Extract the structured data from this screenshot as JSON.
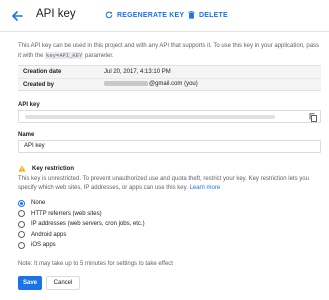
{
  "header": {
    "title": "API key",
    "regenerate_label": "REGENERATE KEY",
    "delete_label": "DELETE"
  },
  "description": {
    "text_before": "This API key can be used in this project and with any API that supports it. To use this key in your application, pass it with the ",
    "code": "key=API_KEY",
    "text_after": " parameter."
  },
  "info": {
    "creation_date_label": "Creation date",
    "creation_date_value": "Jul 20, 2017, 4:13:10 PM",
    "created_by_label": "Created by",
    "created_by_value": "@gmail.com (you)"
  },
  "api_key": {
    "label": "API key"
  },
  "name": {
    "label": "Name",
    "value": "API key"
  },
  "key_restriction": {
    "title": "Key restriction",
    "description": "This key is unrestricted. To prevent unauthorized use and quota theft, restrict your key. Key restriction lets you specify which web sites, IP addresses, or apps can use this key.",
    "learn_more": "Learn more",
    "options": [
      {
        "label": "None",
        "selected": true
      },
      {
        "label": "HTTP referrers (web sites)",
        "selected": false
      },
      {
        "label": "IP addresses (web servers, cron jobs, etc.)",
        "selected": false
      },
      {
        "label": "Android apps",
        "selected": false
      },
      {
        "label": "iOS apps",
        "selected": false
      }
    ]
  },
  "note": "Note: It may take up to 5 minutes for settings to take effect",
  "buttons": {
    "save": "Save",
    "cancel": "Cancel"
  },
  "colors": {
    "accent": "#1a73e8",
    "warning": "#f9ab00"
  },
  "icons": {
    "back": "arrow-back-icon",
    "regenerate": "refresh-icon",
    "delete": "trash-icon",
    "copy": "copy-icon",
    "warning": "warning-icon"
  }
}
